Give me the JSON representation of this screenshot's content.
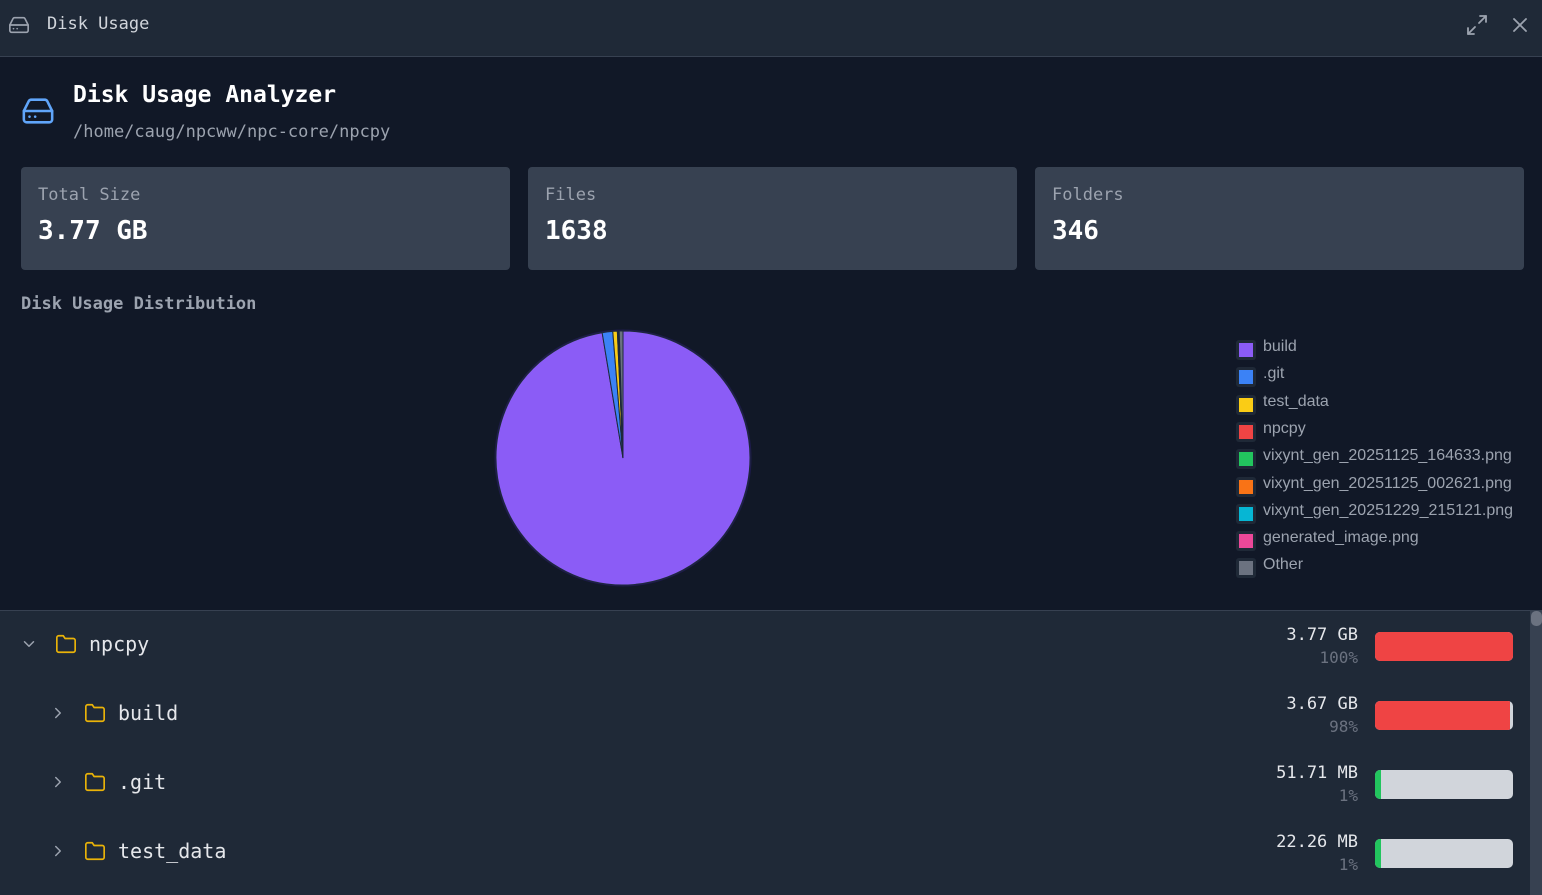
{
  "window": {
    "title": "Disk Usage",
    "icon": "hard-drive-icon",
    "controls": {
      "maximize_icon": "maximize-icon",
      "close_icon": "close-icon"
    }
  },
  "header": {
    "title": "Disk Usage Analyzer",
    "path": "/home/caug/npcww/npc-core/npcpy",
    "icon": "hard-drive-icon"
  },
  "stats": [
    {
      "label": "Total Size",
      "value": "3.77 GB"
    },
    {
      "label": "Files",
      "value": "1638"
    },
    {
      "label": "Folders",
      "value": "346"
    }
  ],
  "distribution": {
    "title": "Disk Usage Distribution"
  },
  "chart_data": {
    "type": "pie",
    "categories": [
      "build",
      ".git",
      "test_data",
      "npcpy",
      "vixynt_gen_20251125_164633.png",
      "vixynt_gen_20251125_002621.png",
      "vixynt_gen_20251229_215121.png",
      "generated_image.png",
      "Other"
    ],
    "values": [
      3.67,
      0.0505,
      0.0217,
      0.003,
      0.002,
      0.0015,
      0.0012,
      0.001,
      0.018
    ],
    "unit": "GB",
    "colors": [
      "#8b5cf6",
      "#3b82f6",
      "#facc15",
      "#ef4444",
      "#22c55e",
      "#f97316",
      "#06b6d4",
      "#ec4899",
      "#6b7280"
    ],
    "legend_position": "right"
  },
  "tree": {
    "rows": [
      {
        "name": "npcpy",
        "size": "3.77 GB",
        "percent": "100%",
        "fraction": 1.0,
        "depth": 0,
        "expanded": true
      },
      {
        "name": "build",
        "size": "3.67 GB",
        "percent": "98%",
        "fraction": 0.98,
        "depth": 1,
        "expanded": false
      },
      {
        "name": ".git",
        "size": "51.71 MB",
        "percent": "1%",
        "fraction": 0.04,
        "depth": 1,
        "expanded": false
      },
      {
        "name": "test_data",
        "size": "22.26 MB",
        "percent": "1%",
        "fraction": 0.04,
        "depth": 1,
        "expanded": false
      }
    ],
    "bar_colors": {
      "high": "#ef4444",
      "low": "#22c55e"
    },
    "folder_icon": "folder-icon"
  }
}
